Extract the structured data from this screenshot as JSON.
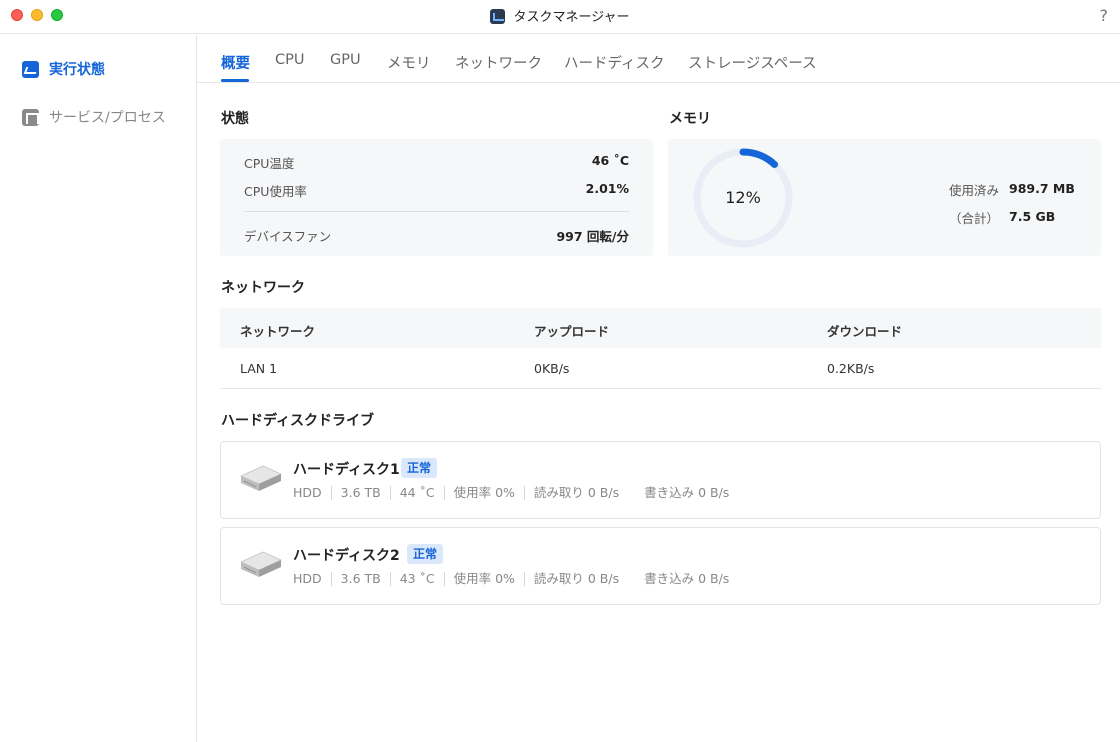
{
  "window": {
    "title": "タスクマネージャー",
    "help": "?"
  },
  "sidebar": {
    "items": [
      {
        "label": "実行状態",
        "icon": "performance-chart-icon",
        "active": true
      },
      {
        "label": "サービス/プロセス",
        "icon": "process-tree-icon",
        "active": false
      }
    ]
  },
  "tabs": [
    "概要",
    "CPU",
    "GPU",
    "メモリ",
    "ネットワーク",
    "ハードディスク",
    "ストレージスペース"
  ],
  "status": {
    "title": "状態",
    "cpu_temp_label": "CPU温度",
    "cpu_temp_value": "46 ˚C",
    "cpu_usage_label": "CPU使用率",
    "cpu_usage_value": "2.01%",
    "fan_label": "デバイスファン",
    "fan_value": "997 回転/分"
  },
  "memory": {
    "title": "メモリ",
    "percent_text": "12%",
    "used_fraction": 0.12,
    "used_label": "使用済み",
    "used_value": "989.7 MB",
    "total_label": "（合計）",
    "total_value": "7.5 GB",
    "accent": "#1565d8"
  },
  "network": {
    "title": "ネットワーク",
    "headers": [
      "ネットワーク",
      "アップロード",
      "ダウンロード"
    ],
    "rows": [
      [
        "LAN 1",
        "0KB/s",
        "0.2KB/s"
      ]
    ]
  },
  "disks": {
    "title": "ハードディスクドライブ",
    "items": [
      {
        "name": "ハードディスク1",
        "status": "正常",
        "type": "HDD",
        "size": "3.6 TB",
        "temp": "44 ˚C",
        "usage": "使用率 0%",
        "read": "読み取り 0 B/s",
        "write": "書き込み 0 B/s"
      },
      {
        "name": "ハードディスク2",
        "status": "正常",
        "type": "HDD",
        "size": "3.6 TB",
        "temp": "43 ˚C",
        "usage": "使用率 0%",
        "read": "読み取り 0 B/s",
        "write": "書き込み 0 B/s"
      }
    ]
  }
}
